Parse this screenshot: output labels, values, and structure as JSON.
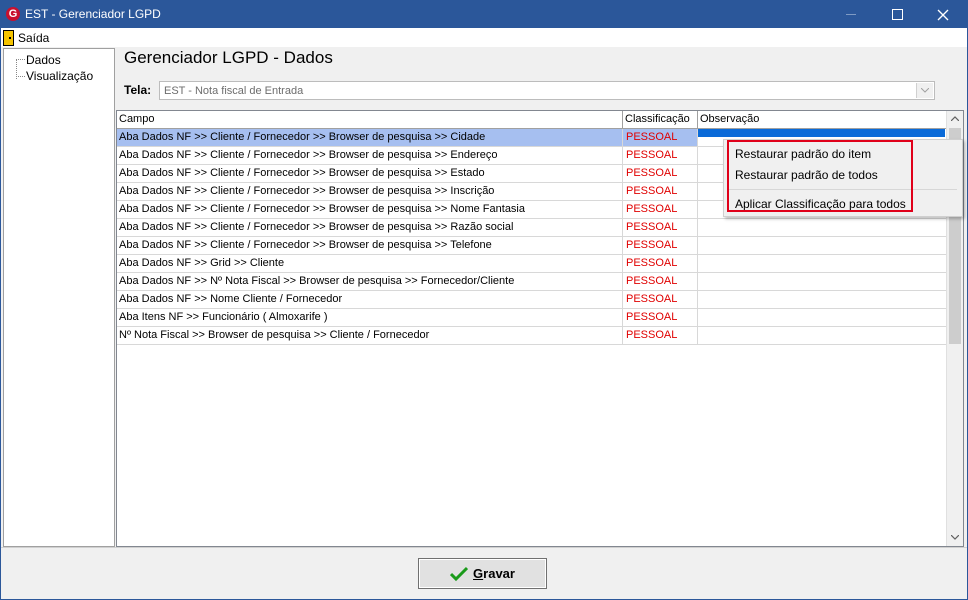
{
  "window": {
    "title": "EST - Gerenciador LGPD",
    "icon_letter": "G",
    "icon": "app-logo-icon"
  },
  "menu": {
    "exit_label": "Saída",
    "exit_icon": "door-exit-icon"
  },
  "tree": {
    "items": [
      {
        "label": "Dados"
      },
      {
        "label": "Visualização"
      }
    ]
  },
  "page": {
    "title": "Gerenciador LGPD - Dados",
    "tela_label": "Tela:",
    "tela_value": "EST - Nota fiscal de Entrada"
  },
  "grid": {
    "columns": [
      "Campo",
      "Classificação",
      "Observação"
    ],
    "rows": [
      {
        "campo": "Aba Dados NF >> Cliente / Fornecedor >> Browser de pesquisa >> Cidade",
        "classificacao": "PESSOAL",
        "observacao": ""
      },
      {
        "campo": "Aba Dados NF >> Cliente / Fornecedor >> Browser de pesquisa >> Endereço",
        "classificacao": "PESSOAL",
        "observacao": ""
      },
      {
        "campo": "Aba Dados NF >> Cliente / Fornecedor >> Browser de pesquisa >> Estado",
        "classificacao": "PESSOAL",
        "observacao": ""
      },
      {
        "campo": "Aba Dados NF >> Cliente / Fornecedor >> Browser de pesquisa >> Inscrição",
        "classificacao": "PESSOAL",
        "observacao": ""
      },
      {
        "campo": "Aba Dados NF >> Cliente / Fornecedor >> Browser de pesquisa >> Nome Fantasia",
        "classificacao": "PESSOAL",
        "observacao": ""
      },
      {
        "campo": "Aba Dados NF >> Cliente / Fornecedor >> Browser de pesquisa >> Razão social",
        "classificacao": "PESSOAL",
        "observacao": ""
      },
      {
        "campo": "Aba Dados NF >> Cliente / Fornecedor >> Browser de pesquisa >> Telefone",
        "classificacao": "PESSOAL",
        "observacao": ""
      },
      {
        "campo": "Aba Dados NF >> Grid  >> Cliente",
        "classificacao": "PESSOAL",
        "observacao": ""
      },
      {
        "campo": "Aba Dados NF >> Nº Nota Fiscal >> Browser de pesquisa >> Fornecedor/Cliente",
        "classificacao": "PESSOAL",
        "observacao": ""
      },
      {
        "campo": "Aba Dados NF >> Nome Cliente / Fornecedor",
        "classificacao": "PESSOAL",
        "observacao": ""
      },
      {
        "campo": "Aba Itens NF >> Funcionário ( Almoxarife )",
        "classificacao": "PESSOAL",
        "observacao": ""
      },
      {
        "campo": "Nº Nota Fiscal >> Browser de pesquisa >> Cliente / Fornecedor",
        "classificacao": "PESSOAL",
        "observacao": ""
      }
    ],
    "selected_row": 0
  },
  "context_menu": {
    "items": [
      {
        "label": "Restaurar padrão do item"
      },
      {
        "label": "Restaurar padrão de todos"
      },
      {
        "label": "Aplicar Classificação para todos"
      }
    ]
  },
  "footer": {
    "save_label_first": "G",
    "save_label_rest": "ravar",
    "save_icon": "check-icon"
  },
  "colors": {
    "titlebar": "#2b579a",
    "selected_row": "#a6bff0",
    "classification_text": "#e00000",
    "highlight_box": "#e0001a",
    "check": "#1a9a1a"
  }
}
